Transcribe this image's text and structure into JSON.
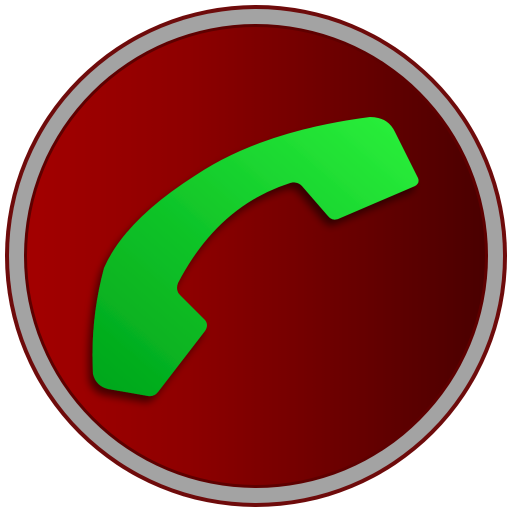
{
  "icon": {
    "name": "phone-call-icon",
    "colors": {
      "outer_border": "#6e0b0b",
      "ring": "#a3a3a3",
      "inner_border": "#5e0000",
      "disc_left": "#a30000",
      "disc_right": "#4a0000",
      "handset_light": "#2cf23c",
      "handset_dark": "#00a51b",
      "handset_shadow": "#2a0000"
    }
  }
}
